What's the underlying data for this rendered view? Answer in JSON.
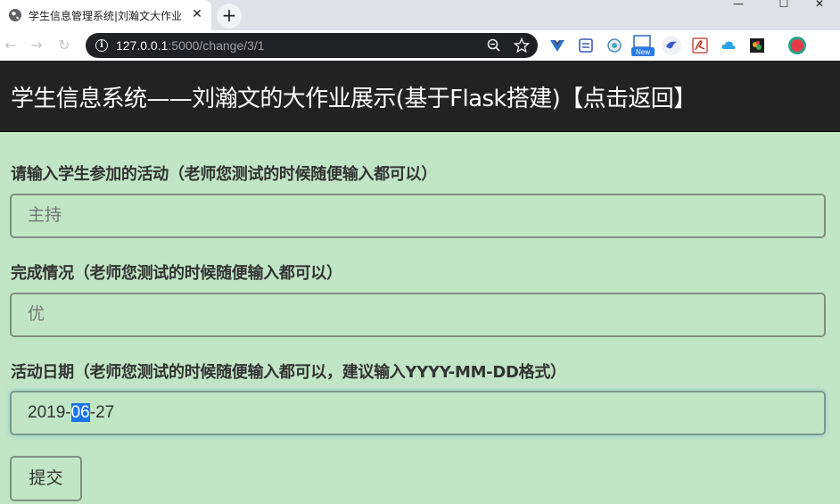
{
  "browser": {
    "tab_title": "学生信息管理系统|刘瀚文大作业",
    "tab_close": "✕",
    "new_tab": "+",
    "url_host": "127.0.0.1",
    "url_rest": ":5000/change/3/1",
    "info_icon": "i"
  },
  "page": {
    "title": "学生信息系统——刘瀚文的大作业展示(基于Flask搭建)【点击返回】"
  },
  "form": {
    "activity_label": "请输入学生参加的活动（老师您测试的时候随便输入都可以）",
    "activity_value": "主持",
    "status_label": "完成情况（老师您测试的时候随便输入都可以）",
    "status_value": "优",
    "date_label": "活动日期（老师您测试的时候随便输入都可以，建议输入YYYY-MM-DD格式）",
    "date_prefix": "2019-",
    "date_selected": "06",
    "date_suffix": "-27",
    "submit_label": "提交"
  }
}
